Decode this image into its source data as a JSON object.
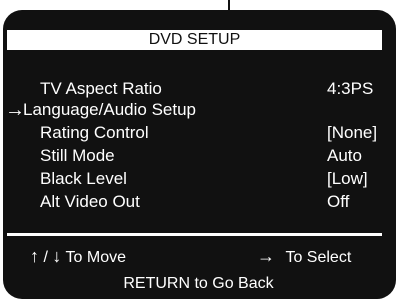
{
  "title": "DVD SETUP",
  "menu": {
    "items": [
      {
        "label": "TV Aspect Ratio",
        "value": "4:3PS"
      },
      {
        "label": "Language/Audio Setup",
        "value": ""
      },
      {
        "label": "Rating Control",
        "value": "[None]"
      },
      {
        "label": "Still Mode",
        "value": "Auto"
      },
      {
        "label": "Black Level",
        "value": "[Low]"
      },
      {
        "label": "Alt Video Out",
        "value": "Off"
      }
    ],
    "selected_index": 1,
    "cursor_glyph": "→"
  },
  "help": {
    "up_glyph": "↑",
    "separator": "/",
    "down_glyph": "↓",
    "move_label": "To Move",
    "right_glyph": "→",
    "select_label": "To Select",
    "return_label": "RETURN to Go Back"
  },
  "colors": {
    "screen_background": "#111111",
    "text": "#ffffff",
    "title_bar": "#ffffff"
  }
}
